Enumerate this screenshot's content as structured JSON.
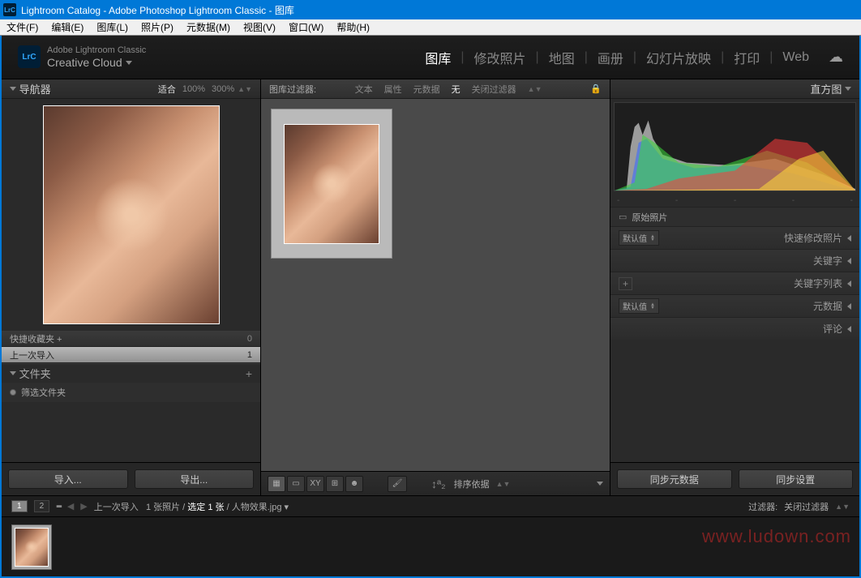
{
  "window": {
    "title": "Lightroom Catalog - Adobe Photoshop Lightroom Classic - 图库"
  },
  "menu": [
    "文件(F)",
    "编辑(E)",
    "图库(L)",
    "照片(P)",
    "元数据(M)",
    "视图(V)",
    "窗口(W)",
    "帮助(H)"
  ],
  "branding": {
    "line1": "Adobe Lightroom Classic",
    "line2": "Creative Cloud"
  },
  "modules": [
    "图库",
    "修改照片",
    "地图",
    "画册",
    "幻灯片放映",
    "打印",
    "Web"
  ],
  "activeModule": "图库",
  "navigator": {
    "title": "导航器",
    "fit": "适合",
    "z100": "100%",
    "z300": "300%"
  },
  "collections": [
    {
      "name": "快捷收藏夹  +",
      "count": "0",
      "selected": false
    },
    {
      "name": "上一次导入",
      "count": "1",
      "selected": true
    }
  ],
  "folders": {
    "title": "文件夹",
    "filter": "筛选文件夹"
  },
  "leftButtons": {
    "import": "导入...",
    "export": "导出..."
  },
  "filterBar": {
    "label": "图库过滤器:",
    "tabs": [
      "文本",
      "属性",
      "元数据",
      "无"
    ],
    "close": "关闭过滤器",
    "active": "无"
  },
  "toolbar": {
    "sort": "排序依据"
  },
  "histogramTitle": "直方图",
  "originalPhoto": "原始照片",
  "rightPanels": [
    {
      "select": "默认值",
      "title": "快速修改照片"
    },
    {
      "select": null,
      "title": "关键字"
    },
    {
      "plus": true,
      "title": "关键字列表"
    },
    {
      "select": "默认值",
      "title": "元数据"
    },
    {
      "select": null,
      "title": "评论"
    }
  ],
  "syncButtons": {
    "meta": "同步元数据",
    "settings": "同步设置"
  },
  "filmstrip": {
    "path_prefix": "上一次导入",
    "count": "1 张照片",
    "selected": "选定 1 张",
    "filename": "人物效果.jpg",
    "filter_label": "过滤器:",
    "filter_value": "关闭过滤器"
  },
  "watermark": "www.ludown.com"
}
